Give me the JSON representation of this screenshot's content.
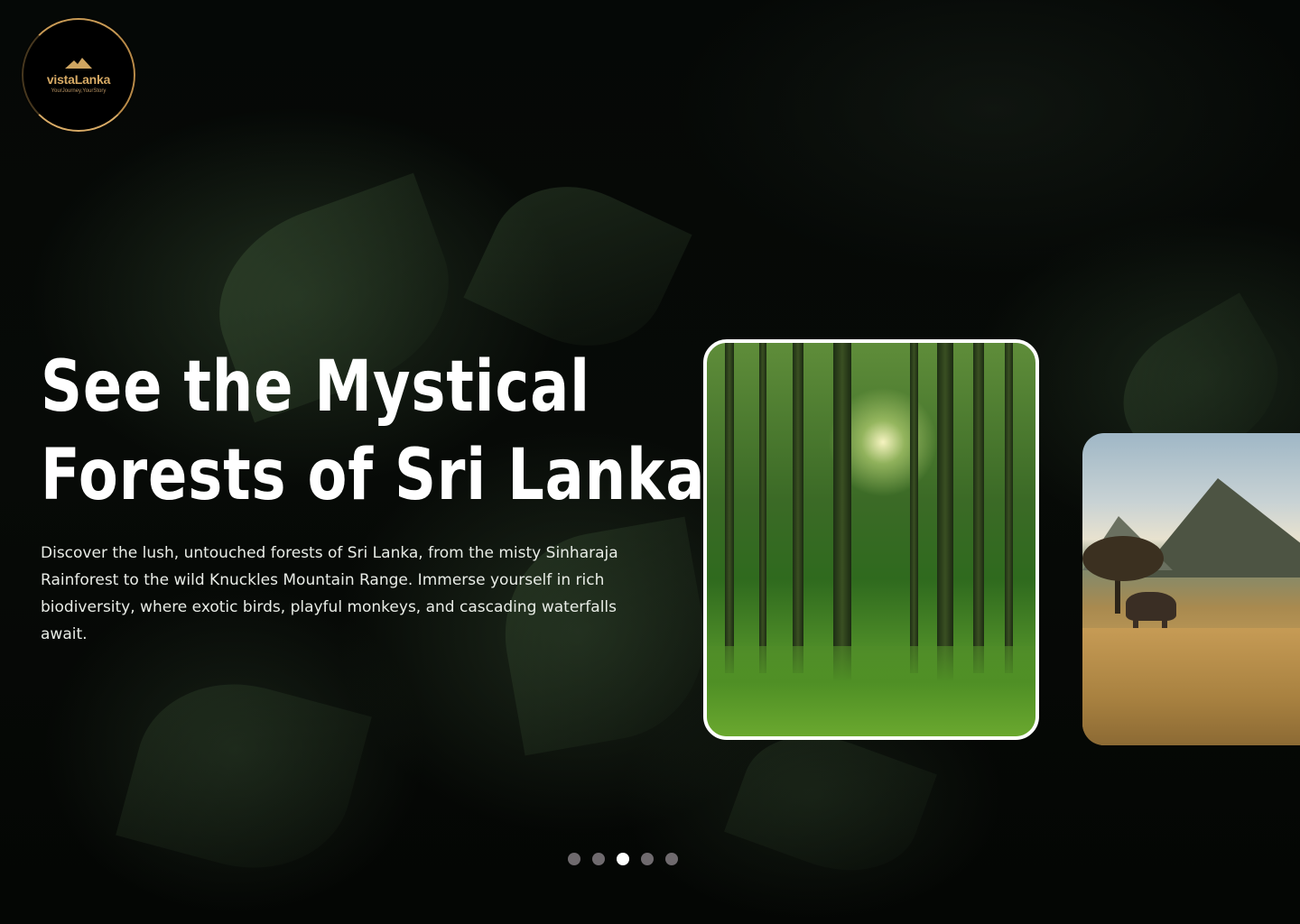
{
  "brand": {
    "name": "vistaLanka",
    "tagline": "YourJourney,YourStory",
    "accent_color": "#d6a964"
  },
  "hero": {
    "title_line1": "See the Mystical",
    "title_line2": "Forests of Sri Lanka",
    "description": "Discover the lush, untouched forests of Sri Lanka, from the misty Sinharaja Rainforest to the wild Knuckles Mountain Range. Immerse yourself in rich biodiversity, where exotic birds, playful monkeys, and cascading waterfalls await."
  },
  "carousel": {
    "cards": [
      {
        "image": "sunlit-forest",
        "state": "active"
      },
      {
        "image": "savanna-elephant-mountains",
        "state": "next"
      }
    ],
    "total_slides": 5,
    "active_index": 2
  },
  "colors": {
    "text_primary": "#ffffff",
    "dot_inactive": "#6f6a6e",
    "dot_active": "#ffffff",
    "card_border": "#ffffff"
  }
}
